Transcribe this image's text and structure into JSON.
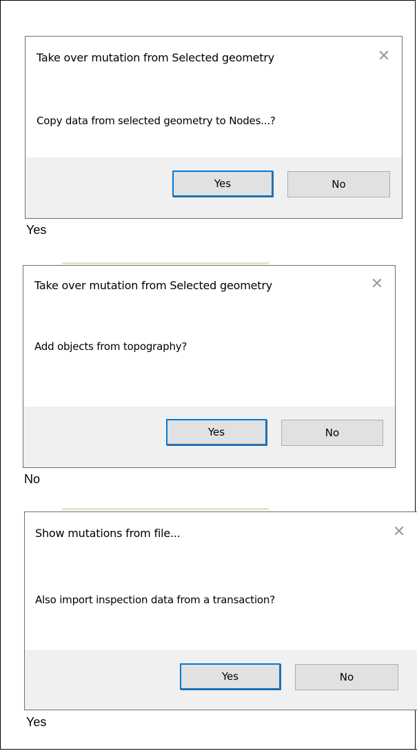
{
  "dialogs": [
    {
      "title": "Take over mutation from Selected geometry",
      "close_glyph": "✕",
      "message": "Copy data from selected geometry to Nodes...?",
      "yes_label": "Yes",
      "no_label": "No",
      "caption": "Yes"
    },
    {
      "title": "Take over mutation from Selected geometry",
      "close_glyph": "✕",
      "message": "Add objects from topography?",
      "yes_label": "Yes",
      "no_label": "No",
      "caption": "No"
    },
    {
      "title": "Show mutations from file...",
      "close_glyph": "✕",
      "message": "Also import inspection data from a transaction?",
      "yes_label": "Yes",
      "no_label": "No",
      "caption": "Yes"
    }
  ],
  "icons": {
    "close": "close-icon"
  },
  "colors": {
    "default_button_border": "#0078d7",
    "footer_background": "#f0f0f0",
    "button_face": "#e1e1e1",
    "close_glyph": "#9a9a9a"
  }
}
